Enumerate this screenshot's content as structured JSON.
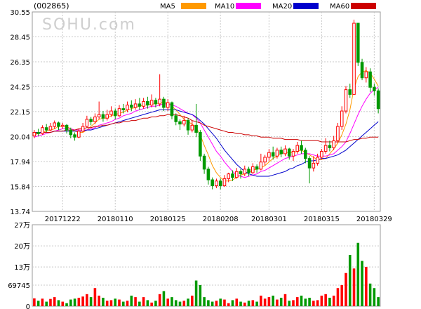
{
  "stock_code": "(002865)",
  "watermark": "SOHU.com",
  "legend": [
    {
      "name": "MA5",
      "color": "#ff9900"
    },
    {
      "name": "MA10",
      "color": "#ff00ff"
    },
    {
      "name": "MA20",
      "color": "#0000cc"
    },
    {
      "name": "MA60",
      "color": "#cc0000"
    }
  ],
  "colors": {
    "up": "#ff0000",
    "down": "#009900",
    "grid": "#c8c8c8"
  },
  "chart_data": [
    {
      "type": "candlestick",
      "ylim": [
        13.74,
        30.55
      ],
      "ytick_labels": [
        "30.55",
        "28.45",
        "26.35",
        "24.25",
        "22.15",
        "20.04",
        "17.94",
        "15.84",
        "13.74"
      ],
      "ytick_values": [
        30.55,
        28.45,
        26.35,
        24.25,
        22.15,
        20.04,
        17.94,
        15.84,
        13.74
      ],
      "xtick_labels": [
        "20171222",
        "20180110",
        "20180125",
        "20180208",
        "20180301",
        "20180315",
        "20180329"
      ],
      "xtick_index": [
        7,
        20,
        33,
        46,
        58,
        71,
        84
      ],
      "candles": [
        [
          20.1,
          20.4,
          20.6,
          19.9
        ],
        [
          20.4,
          20.3,
          20.7,
          20.1
        ],
        [
          20.3,
          20.8,
          21.0,
          20.2
        ],
        [
          20.8,
          20.6,
          21.1,
          20.4
        ],
        [
          20.6,
          20.9,
          21.2,
          20.5
        ],
        [
          20.9,
          21.2,
          21.4,
          20.7
        ],
        [
          21.2,
          20.9,
          21.3,
          20.6
        ],
        [
          20.9,
          21.0,
          21.2,
          20.7
        ],
        [
          21.0,
          20.6,
          21.1,
          20.3
        ],
        [
          20.6,
          20.2,
          20.8,
          19.9
        ],
        [
          20.2,
          20.0,
          20.4,
          19.7
        ],
        [
          20.0,
          20.5,
          20.7,
          19.9
        ],
        [
          20.5,
          20.9,
          21.2,
          20.4
        ],
        [
          20.9,
          21.5,
          21.8,
          20.8
        ],
        [
          21.5,
          21.3,
          21.7,
          21.0
        ],
        [
          21.3,
          21.7,
          22.0,
          21.1
        ],
        [
          21.7,
          21.9,
          23.0,
          21.5
        ],
        [
          21.9,
          21.6,
          22.2,
          21.3
        ],
        [
          21.6,
          21.9,
          22.3,
          21.4
        ],
        [
          21.9,
          22.2,
          22.6,
          21.7
        ],
        [
          22.2,
          21.8,
          22.4,
          21.5
        ],
        [
          21.8,
          22.4,
          22.7,
          21.7
        ],
        [
          22.4,
          22.3,
          22.8,
          22.0
        ],
        [
          22.3,
          22.7,
          23.0,
          22.1
        ],
        [
          22.7,
          22.5,
          23.1,
          22.2
        ],
        [
          22.5,
          22.8,
          23.2,
          22.3
        ],
        [
          22.8,
          22.6,
          23.3,
          22.3
        ],
        [
          22.6,
          23.0,
          23.3,
          22.4
        ],
        [
          23.0,
          22.7,
          23.4,
          22.4
        ],
        [
          22.7,
          23.1,
          23.6,
          22.5
        ],
        [
          23.1,
          22.8,
          23.3,
          22.5
        ],
        [
          22.8,
          23.2,
          25.3,
          22.6
        ],
        [
          23.2,
          22.5,
          23.4,
          22.2
        ],
        [
          22.5,
          22.9,
          23.2,
          22.2
        ],
        [
          22.9,
          21.8,
          23.0,
          21.5
        ],
        [
          21.8,
          21.3,
          22.0,
          21.0
        ],
        [
          21.3,
          21.1,
          21.5,
          20.6
        ],
        [
          21.1,
          21.4,
          21.8,
          20.9
        ],
        [
          21.4,
          20.6,
          21.6,
          20.2
        ],
        [
          20.6,
          21.0,
          21.4,
          20.4
        ],
        [
          21.0,
          20.4,
          22.8,
          20.0
        ],
        [
          20.4,
          18.4,
          20.6,
          18.0
        ],
        [
          18.4,
          17.3,
          18.6,
          16.9
        ],
        [
          17.3,
          16.4,
          17.5,
          16.0
        ],
        [
          16.4,
          15.9,
          16.6,
          15.6
        ],
        [
          15.9,
          16.3,
          16.5,
          15.7
        ],
        [
          16.3,
          15.9,
          16.5,
          15.6
        ],
        [
          15.9,
          16.5,
          16.8,
          15.8
        ],
        [
          16.5,
          16.9,
          17.0,
          16.2
        ],
        [
          16.9,
          16.6,
          17.2,
          16.3
        ],
        [
          16.6,
          17.1,
          17.4,
          16.5
        ],
        [
          17.1,
          16.9,
          17.3,
          16.5
        ],
        [
          16.9,
          17.3,
          17.6,
          16.7
        ],
        [
          17.3,
          17.0,
          17.5,
          16.7
        ],
        [
          17.0,
          17.5,
          17.8,
          16.9
        ],
        [
          17.5,
          17.3,
          17.7,
          17.0
        ],
        [
          17.3,
          17.9,
          18.6,
          17.2
        ],
        [
          17.9,
          18.3,
          18.5,
          17.6
        ],
        [
          18.3,
          18.7,
          19.0,
          18.0
        ],
        [
          18.7,
          18.4,
          19.2,
          18.1
        ],
        [
          18.4,
          18.9,
          19.1,
          18.2
        ],
        [
          18.9,
          18.6,
          19.2,
          18.3
        ],
        [
          18.6,
          19.0,
          19.3,
          18.4
        ],
        [
          19.0,
          18.4,
          19.1,
          18.1
        ],
        [
          18.4,
          18.8,
          19.0,
          18.0
        ],
        [
          18.8,
          19.3,
          19.6,
          18.6
        ],
        [
          19.3,
          18.9,
          19.7,
          18.6
        ],
        [
          18.9,
          18.2,
          19.1,
          17.8
        ],
        [
          18.2,
          17.4,
          18.4,
          16.1
        ],
        [
          17.4,
          17.8,
          18.4,
          17.1
        ],
        [
          17.8,
          18.3,
          18.6,
          17.6
        ],
        [
          18.3,
          18.8,
          19.0,
          18.1
        ],
        [
          18.8,
          19.3,
          19.9,
          18.6
        ],
        [
          19.3,
          19.1,
          19.7,
          18.8
        ],
        [
          19.1,
          19.7,
          20.1,
          18.9
        ],
        [
          19.7,
          20.9,
          21.2,
          19.5
        ],
        [
          20.9,
          22.2,
          22.6,
          20.6
        ],
        [
          22.2,
          24.0,
          24.3,
          22.0
        ],
        [
          24.0,
          23.6,
          24.5,
          23.3
        ],
        [
          23.6,
          29.6,
          29.9,
          26.5
        ],
        [
          29.6,
          26.3,
          26.7,
          26.0
        ],
        [
          26.3,
          25.0,
          26.6,
          24.8
        ],
        [
          25.0,
          25.5,
          25.9,
          24.6
        ],
        [
          25.5,
          24.2,
          25.8,
          23.8
        ],
        [
          24.2,
          23.9,
          24.5,
          23.5
        ],
        [
          23.9,
          22.4,
          24.1,
          22.0
        ]
      ],
      "ma5": [
        20.2,
        20.3,
        20.4,
        20.5,
        20.6,
        20.7,
        20.9,
        20.9,
        20.9,
        20.7,
        20.5,
        20.4,
        20.4,
        20.6,
        20.9,
        21.2,
        21.5,
        21.6,
        21.6,
        21.8,
        21.9,
        22.0,
        22.1,
        22.3,
        22.4,
        22.5,
        22.6,
        22.7,
        22.7,
        22.8,
        22.8,
        22.9,
        22.9,
        22.9,
        22.6,
        22.3,
        21.9,
        21.5,
        21.3,
        21.1,
        20.8,
        20.2,
        19.3,
        18.5,
        17.6,
        17.0,
        16.6,
        16.3,
        16.3,
        16.4,
        16.6,
        16.8,
        16.9,
        17.0,
        17.2,
        17.3,
        17.4,
        17.6,
        17.9,
        18.2,
        18.4,
        18.6,
        18.7,
        18.7,
        18.7,
        18.8,
        18.9,
        18.7,
        18.5,
        18.3,
        18.1,
        18.1,
        18.2,
        18.6,
        19.0,
        19.5,
        20.2,
        21.1,
        22.3,
        24.1,
        25.1,
        25.5,
        25.6,
        25.4,
        24.9,
        24.3
      ],
      "ma10": [
        20.0,
        20.1,
        20.2,
        20.3,
        20.4,
        20.5,
        20.6,
        20.7,
        20.7,
        20.7,
        20.6,
        20.6,
        20.6,
        20.6,
        20.7,
        20.8,
        21.0,
        21.1,
        21.2,
        21.3,
        21.5,
        21.6,
        21.8,
        21.9,
        22.0,
        22.2,
        22.3,
        22.4,
        22.5,
        22.6,
        22.6,
        22.7,
        22.8,
        22.8,
        22.7,
        22.6,
        22.4,
        22.2,
        22.0,
        21.9,
        21.6,
        21.2,
        20.6,
        20.0,
        19.4,
        18.8,
        18.4,
        17.9,
        17.5,
        17.1,
        16.8,
        16.7,
        16.6,
        16.7,
        16.8,
        16.9,
        17.1,
        17.2,
        17.4,
        17.6,
        17.8,
        18.0,
        18.2,
        18.3,
        18.4,
        18.5,
        18.6,
        18.6,
        18.6,
        18.5,
        18.4,
        18.4,
        18.4,
        18.5,
        18.6,
        18.9,
        19.2,
        19.6,
        20.3,
        21.1,
        21.9,
        22.6,
        23.2,
        23.7,
        24.0,
        24.2
      ],
      "ma20": [
        20.4,
        20.4,
        20.4,
        20.4,
        20.4,
        20.5,
        20.5,
        20.5,
        20.5,
        20.5,
        20.5,
        20.5,
        20.5,
        20.6,
        20.6,
        20.7,
        20.8,
        20.9,
        21.0,
        21.1,
        21.2,
        21.3,
        21.4,
        21.5,
        21.6,
        21.7,
        21.8,
        21.9,
        22.0,
        22.1,
        22.2,
        22.3,
        22.3,
        22.3,
        22.3,
        22.3,
        22.2,
        22.1,
        22.0,
        21.9,
        21.7,
        21.4,
        21.1,
        20.7,
        20.3,
        19.9,
        19.4,
        18.9,
        18.5,
        18.1,
        17.7,
        17.4,
        17.1,
        16.9,
        16.8,
        16.7,
        16.7,
        16.7,
        16.7,
        16.8,
        16.9,
        17.0,
        17.1,
        17.3,
        17.4,
        17.6,
        17.7,
        17.9,
        18.0,
        18.0,
        18.1,
        18.2,
        18.2,
        18.3,
        18.4,
        18.5,
        18.7,
        18.9,
        19.2,
        19.5,
        19.8,
        20.1,
        20.4,
        20.7,
        21.0,
        21.3
      ],
      "ma60": [
        20.3,
        20.3,
        20.4,
        20.4,
        20.4,
        20.5,
        20.5,
        20.5,
        20.6,
        20.6,
        20.6,
        20.7,
        20.7,
        20.8,
        20.8,
        20.9,
        20.9,
        21.0,
        21.0,
        21.1,
        21.2,
        21.2,
        21.3,
        21.3,
        21.4,
        21.4,
        21.5,
        21.6,
        21.6,
        21.7,
        21.7,
        21.8,
        21.8,
        21.9,
        21.9,
        21.9,
        21.8,
        21.7,
        21.6,
        21.4,
        21.3,
        21.2,
        21.0,
        20.9,
        20.8,
        20.7,
        20.6,
        20.5,
        20.4,
        20.4,
        20.3,
        20.3,
        20.2,
        20.2,
        20.1,
        20.1,
        20.0,
        20.0,
        20.0,
        19.9,
        19.9,
        19.9,
        19.8,
        19.8,
        19.8,
        19.8,
        19.7,
        19.7,
        19.7,
        19.7,
        19.7,
        19.6,
        19.6,
        19.6,
        19.6,
        19.6,
        19.6,
        19.6,
        19.7,
        19.8,
        19.8,
        19.9,
        19.9,
        20.0,
        20.0,
        20.0
      ]
    },
    {
      "type": "bar",
      "unit_label": "万",
      "ylim": [
        0,
        270000
      ],
      "ytick_labels": [
        "27万",
        "20万",
        "13万",
        "69745",
        "0"
      ],
      "ytick_values": [
        270000,
        200000,
        130000,
        69745,
        0
      ],
      "values": [
        26000,
        18000,
        25000,
        15000,
        24000,
        30000,
        20000,
        15000,
        10000,
        22000,
        25000,
        28000,
        32000,
        40000,
        30000,
        60000,
        35000,
        28000,
        18000,
        20000,
        25000,
        22000,
        15000,
        18000,
        35000,
        30000,
        15000,
        30000,
        20000,
        12000,
        18000,
        40000,
        50000,
        25000,
        30000,
        20000,
        15000,
        18000,
        25000,
        35000,
        85000,
        70000,
        30000,
        20000,
        15000,
        18000,
        25000,
        22000,
        10000,
        20000,
        25000,
        15000,
        12000,
        18000,
        20000,
        15000,
        35000,
        25000,
        30000,
        35000,
        22000,
        28000,
        40000,
        18000,
        20000,
        30000,
        35000,
        25000,
        28000,
        18000,
        20000,
        35000,
        40000,
        28000,
        35000,
        60000,
        70000,
        110000,
        170000,
        125000,
        210000,
        150000,
        130000,
        75000,
        60000,
        30000
      ]
    }
  ]
}
